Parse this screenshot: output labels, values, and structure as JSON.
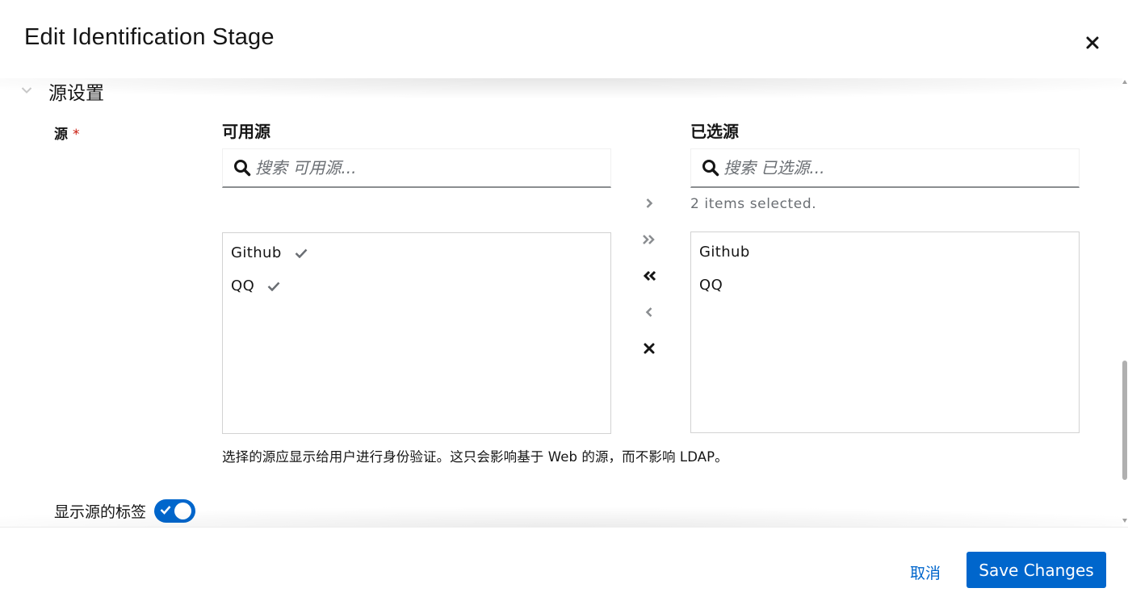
{
  "modal": {
    "title": "Edit Identification Stage",
    "close_icon": "close-icon"
  },
  "section": {
    "title": "源设置",
    "toggle_icon": "chevron-down-icon"
  },
  "field": {
    "label": "源",
    "required_marker": "*"
  },
  "available": {
    "title": "可用源",
    "search_placeholder": "搜索 可用源...",
    "items": [
      {
        "label": "Github",
        "checked": true
      },
      {
        "label": "QQ",
        "checked": true
      }
    ]
  },
  "chosen": {
    "title": "已选源",
    "search_placeholder": "搜索 已选源...",
    "status": "2 items selected.",
    "items": [
      {
        "label": "Github"
      },
      {
        "label": "QQ"
      }
    ]
  },
  "controls": {
    "add_selected_icon": "angle-right-icon",
    "add_all_icon": "angle-double-right-icon",
    "remove_all_icon": "angle-double-left-icon",
    "remove_selected_icon": "angle-left-icon",
    "clear_icon": "times-icon"
  },
  "helper_text": "选择的源应显示给用户进行身份验证。这只会影响基于 Web 的源，而不影响 LDAP。",
  "switch": {
    "label": "显示源的标签",
    "checked": true
  },
  "footer": {
    "cancel_label": "取消",
    "save_label": "Save Changes"
  },
  "colors": {
    "primary": "#0066cc",
    "required": "#c9190b",
    "muted_text": "#6a6e73",
    "border": "#d2d2d2"
  }
}
